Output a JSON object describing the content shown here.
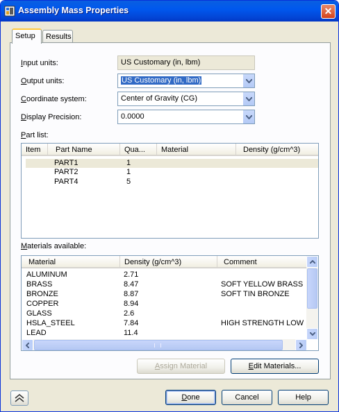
{
  "window": {
    "title": "Assembly Mass Properties"
  },
  "tabs": [
    {
      "label": "Setup"
    },
    {
      "label": "Results"
    }
  ],
  "setup": {
    "input_units": {
      "label_u": "I",
      "label_rest": "nput units:",
      "value": "US Customary (in, lbm)"
    },
    "output_units": {
      "label_u": "O",
      "label_rest": "utput units:",
      "value": "US Customary (in, lbm)"
    },
    "coordinate_system": {
      "label_u": "C",
      "label_rest": "oordinate system:",
      "value": "Center of Gravity (CG)"
    },
    "display_precision": {
      "label_u": "D",
      "label_rest": "isplay Precision:",
      "value": "0.0000"
    }
  },
  "part_list": {
    "label_u": "P",
    "label_rest": "art list:",
    "columns": [
      "Item",
      "Part Name",
      "Qua...",
      "Material",
      "Density (g/cm^3)"
    ],
    "rows": [
      {
        "item": "",
        "part": "PART1",
        "qty": "1",
        "material": "",
        "density": ""
      },
      {
        "item": "",
        "part": "PART2",
        "qty": "1",
        "material": "",
        "density": ""
      },
      {
        "item": "",
        "part": "PART4",
        "qty": "5",
        "material": "",
        "density": ""
      }
    ]
  },
  "materials": {
    "label_u": "M",
    "label_rest": "aterials available:",
    "columns": [
      "Material",
      "Density (g/cm^3)",
      "Comment"
    ],
    "rows": [
      {
        "name": "ALUMINUM",
        "density": "2.71",
        "comment": ""
      },
      {
        "name": "BRASS",
        "density": "8.47",
        "comment": "SOFT YELLOW BRASS"
      },
      {
        "name": "BRONZE",
        "density": "8.87",
        "comment": "SOFT TIN BRONZE"
      },
      {
        "name": "COPPER",
        "density": "8.94",
        "comment": ""
      },
      {
        "name": "GLASS",
        "density": "2.6",
        "comment": ""
      },
      {
        "name": "HSLA_STEEL",
        "density": "7.84",
        "comment": "HIGH STRENGTH LOW"
      },
      {
        "name": "LEAD",
        "density": "11.4",
        "comment": ""
      }
    ]
  },
  "buttons": {
    "assign_u": "A",
    "assign_rest": "ssign Material",
    "edit_u": "E",
    "edit_rest": "dit Materials...",
    "done_u": "D",
    "done_rest": "one",
    "cancel": "Cancel",
    "help": "Help"
  },
  "colors": {
    "titlebar": "#0058ee",
    "face": "#ece9d8",
    "selection": "#316ac5"
  }
}
